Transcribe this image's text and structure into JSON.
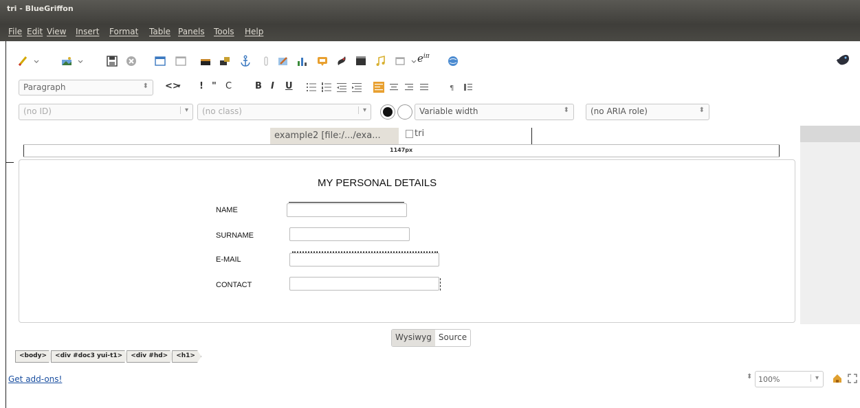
{
  "window": {
    "title": "tri - BlueGriffon"
  },
  "menu": [
    "File",
    "Edit",
    "View",
    "Insert",
    "Format",
    "Table",
    "Panels",
    "Tools",
    "Help"
  ],
  "toolbar": {
    "icons": [
      "pen-icon",
      "image-icon",
      "save-icon",
      "close-circle-icon",
      "window-icon",
      "blank-page-icon",
      "picture-icon",
      "picture-alt-icon",
      "anchor-icon",
      "bolt-icon",
      "picture-edit-icon",
      "chart-icon",
      "form-icon",
      "paint-icon",
      "video-icon",
      "music-icon",
      "layer-icon",
      "math-icon",
      "globe-icon"
    ],
    "math_label": "e^{iπ}"
  },
  "format": {
    "paragraph_select": "Paragraph",
    "buttons": [
      "<>",
      "!",
      "\"",
      "C",
      "B",
      "I",
      "U"
    ]
  },
  "props": {
    "id_placeholder": "(no ID)",
    "class_placeholder": "(no class)",
    "width_select": "Variable width",
    "aria_select": "(no ARIA role)"
  },
  "tabs": {
    "active": "example2 [file:/.../exa...",
    "second": "tri"
  },
  "ruler": {
    "label": "1147px"
  },
  "document": {
    "heading": "MY PERSONAL DETAILS",
    "fields": [
      {
        "label": "NAME"
      },
      {
        "label": "SURNAME"
      },
      {
        "label": "E-MAIL"
      },
      {
        "label": "CONTACT"
      }
    ]
  },
  "view_tabs": {
    "wysiwyg": "Wysiwyg",
    "source": "Source"
  },
  "breadcrumbs": [
    "<body>",
    "<div #doc3 yui-t1>",
    "<div #hd>",
    "<h1>"
  ],
  "footer": {
    "addons": "Get add-ons!",
    "zoom": "100%"
  },
  "colors": {
    "title_bar": "#45443f",
    "link": "#1a4fa0"
  }
}
